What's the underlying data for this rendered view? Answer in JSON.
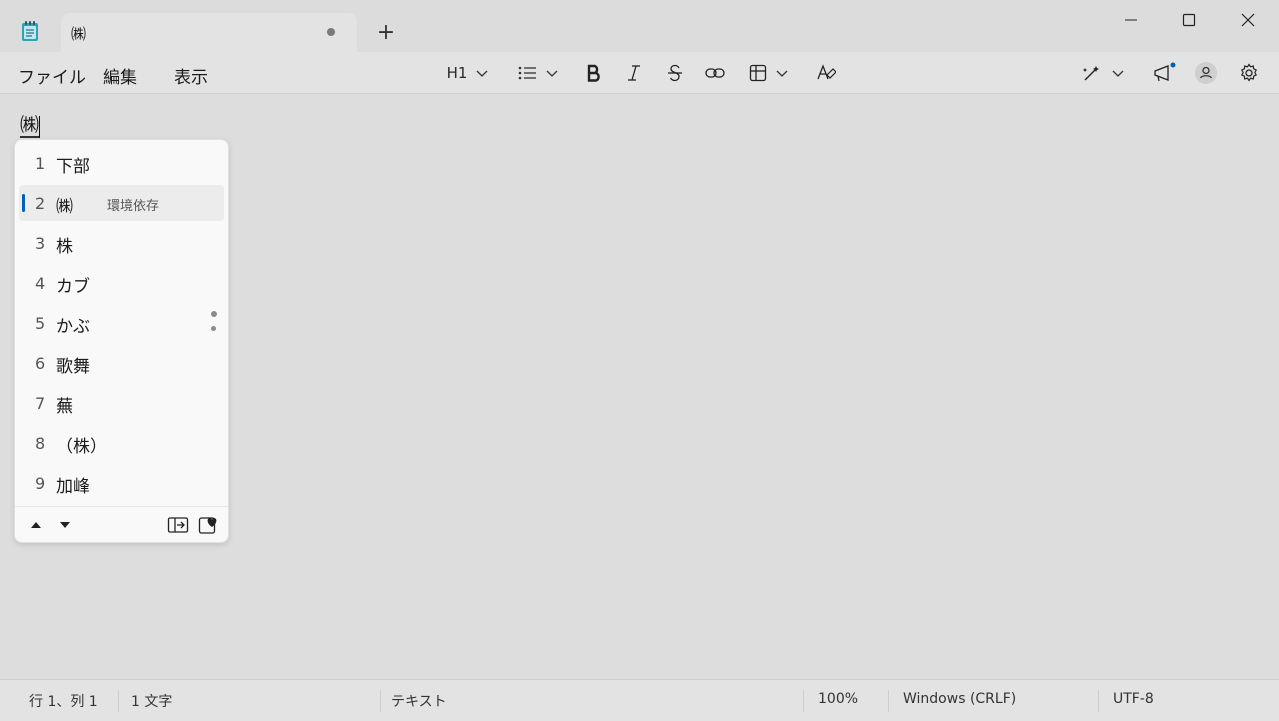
{
  "window": {
    "tab_title": "㈱",
    "new_tab_icon": "+",
    "min_icon": "minimize-icon",
    "max_icon": "maximize-icon",
    "close_icon": "close-icon"
  },
  "menu": {
    "items": [
      "ファイル",
      "編集",
      "表示"
    ]
  },
  "toolbar": {
    "heading_label": "H1"
  },
  "editor": {
    "text": "㈱"
  },
  "ime": {
    "candidates": [
      {
        "num": "1",
        "text": "下部",
        "note": ""
      },
      {
        "num": "2",
        "text": "㈱",
        "note": "環境依存"
      },
      {
        "num": "3",
        "text": "株",
        "note": ""
      },
      {
        "num": "4",
        "text": "カブ",
        "note": ""
      },
      {
        "num": "5",
        "text": "かぶ",
        "note": ""
      },
      {
        "num": "6",
        "text": "歌舞",
        "note": ""
      },
      {
        "num": "7",
        "text": "蕪",
        "note": ""
      },
      {
        "num": "8",
        "text": "（株）",
        "note": ""
      },
      {
        "num": "9",
        "text": "加峰",
        "note": ""
      }
    ],
    "selected_index": 1
  },
  "status": {
    "position": "行 1、列 1",
    "chars": "1 文字",
    "mode": "テキスト",
    "zoom": "100%",
    "line_ending": "Windows (CRLF)",
    "encoding": "UTF-8"
  },
  "colors": {
    "accent": "#005fb8",
    "background": "#dddddd"
  }
}
